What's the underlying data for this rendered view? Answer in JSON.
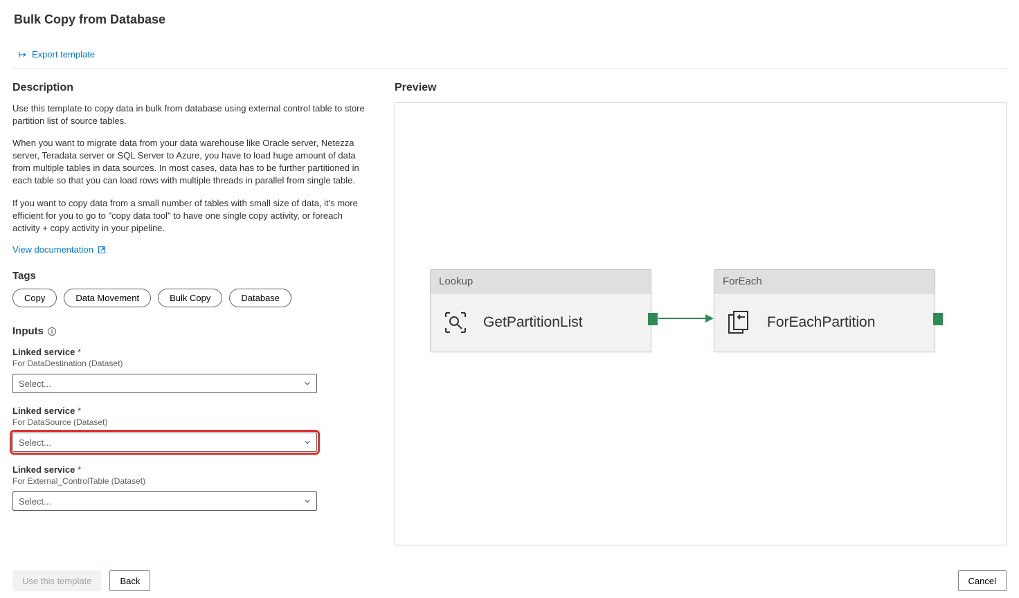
{
  "pageTitle": "Bulk Copy from Database",
  "toolbar": {
    "exportTemplate": "Export template"
  },
  "description": {
    "heading": "Description",
    "para1": "Use this template to copy data in bulk from database using external control table to store partition list of source tables.",
    "para2": "When you want to migrate data from your data warehouse like Oracle server, Netezza server, Teradata server or SQL Server to Azure, you have to load huge amount of data from multiple tables in data sources. In most cases, data has to be further partitioned in each table so that you can load rows with multiple threads in parallel from single table.",
    "para3": "If you want to copy data from a small number of tables with small size of data, it's more efficient for you to go to \"copy data tool\" to have one single copy activity, or foreach activity + copy activity in your pipeline.",
    "docLink": "View documentation"
  },
  "tags": {
    "heading": "Tags",
    "items": [
      "Copy",
      "Data Movement",
      "Bulk Copy",
      "Database"
    ]
  },
  "inputs": {
    "heading": "Inputs",
    "groups": [
      {
        "label": "Linked service",
        "sub": "For DataDestination (Dataset)",
        "placeholder": "Select...",
        "highlighted": false
      },
      {
        "label": "Linked service",
        "sub": "For DataSource (Dataset)",
        "placeholder": "Select...",
        "highlighted": true
      },
      {
        "label": "Linked service",
        "sub": "For External_ControlTable (Dataset)",
        "placeholder": "Select...",
        "highlighted": false
      }
    ]
  },
  "preview": {
    "heading": "Preview",
    "activities": [
      {
        "type": "Lookup",
        "name": "GetPartitionList"
      },
      {
        "type": "ForEach",
        "name": "ForEachPartition"
      }
    ]
  },
  "footer": {
    "useTemplate": "Use this template",
    "back": "Back",
    "cancel": "Cancel"
  }
}
